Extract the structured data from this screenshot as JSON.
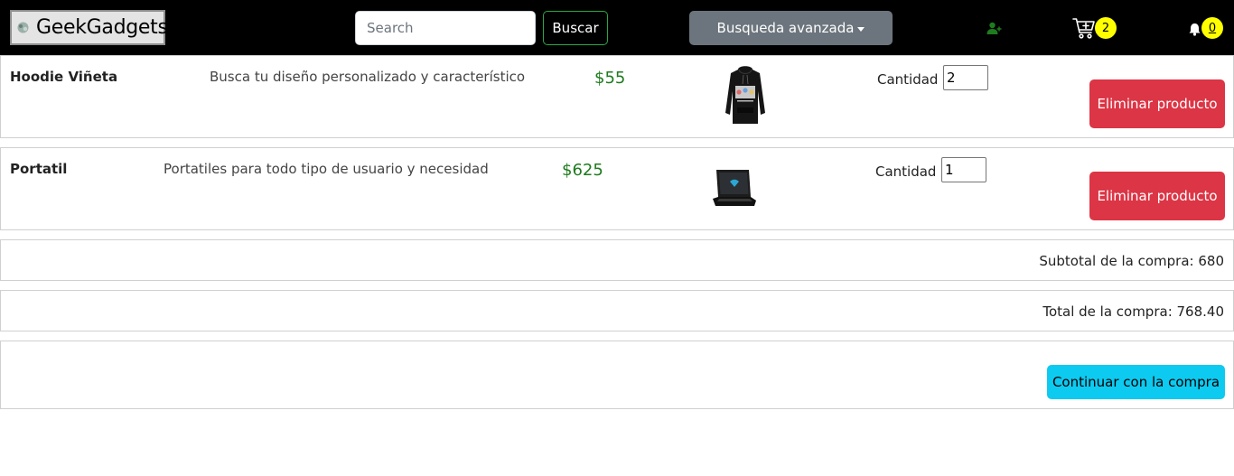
{
  "navbar": {
    "brand": "GeekGadgets",
    "search_placeholder": "Search",
    "search_button": "Buscar",
    "advanced_search": "Busqueda avanzada",
    "cart_count": "2",
    "notification_count": "0",
    "colors": {
      "background": "#000000",
      "badge": "#ffff00",
      "user_icon": "#1e7b1e"
    }
  },
  "cart": {
    "items": [
      {
        "name": "Hoodie Viñeta",
        "description": "Busca tu diseño personalizado y característico",
        "price": "$55",
        "image_icon": "hoodie-image",
        "quantity_label": "Cantidad :",
        "quantity": "2",
        "remove_label": "Eliminar producto"
      },
      {
        "name": "Portatil",
        "description": "Portatiles para todo tipo de usuario y necesidad",
        "price": "$625",
        "image_icon": "laptop-image",
        "quantity_label": "Cantidad :",
        "quantity": "1",
        "remove_label": "Eliminar producto"
      }
    ],
    "subtotal": "Subtotal de la compra: 680",
    "total": "Total de la compra: 768.40",
    "continue_label": "Continuar con la compra",
    "colors": {
      "price": "#1e7b1e",
      "remove": "#dc3545",
      "continue": "#0dcaf0"
    }
  }
}
